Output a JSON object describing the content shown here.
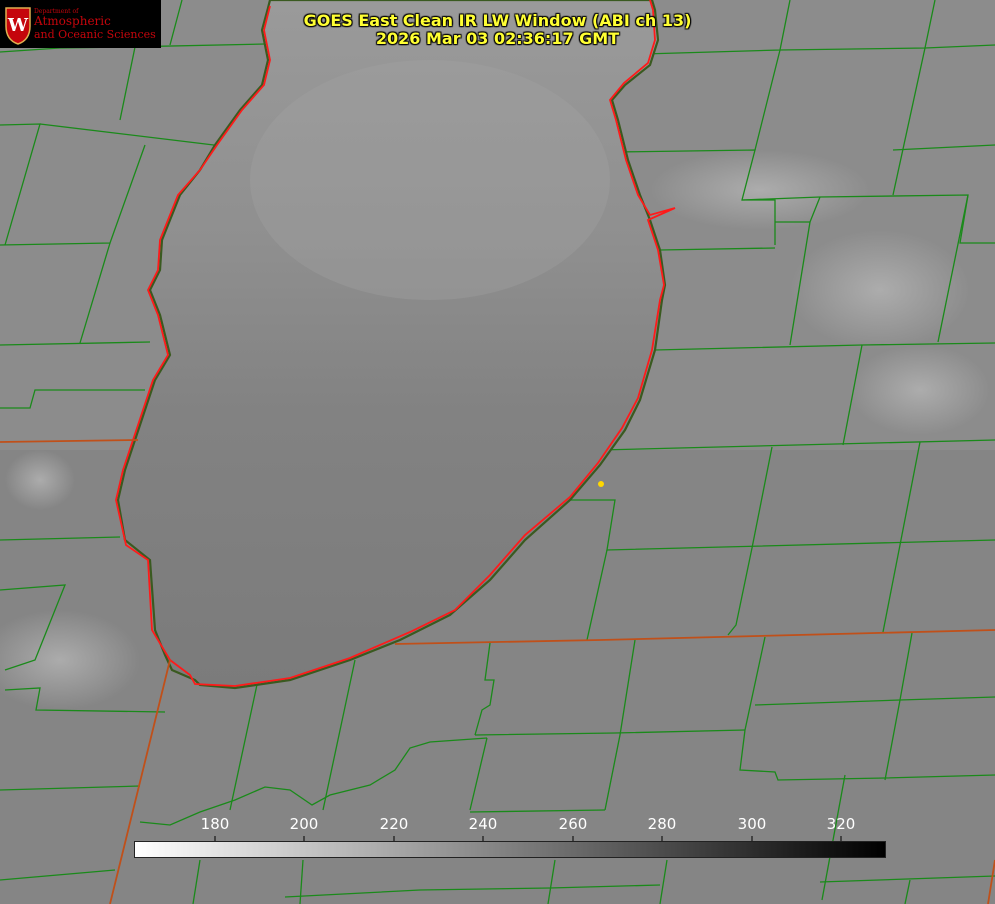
{
  "title": {
    "line1": "GOES East Clean IR LW Window (ABI ch 13)",
    "line2": "2026 Mar 03 02:36:17 GMT"
  },
  "logo": {
    "dept": "Department of",
    "line1": "Atmospheric",
    "line2": "and Oceanic Sciences",
    "seal_letter": "W"
  },
  "colorbar": {
    "ticks": [
      "180",
      "200",
      "220",
      "240",
      "260",
      "280",
      "300",
      "320"
    ],
    "gradient_start": "#ffffff",
    "gradient_end": "#000000"
  },
  "colors": {
    "county_lines": "#1a8a1a",
    "state_border": "#c0501a",
    "coastline_red": "#ff1a1a",
    "title": "#ffff33",
    "marker": "#ffd700"
  },
  "icons": {
    "logo": "uw-seal-icon",
    "marker": "station-dot-icon"
  }
}
